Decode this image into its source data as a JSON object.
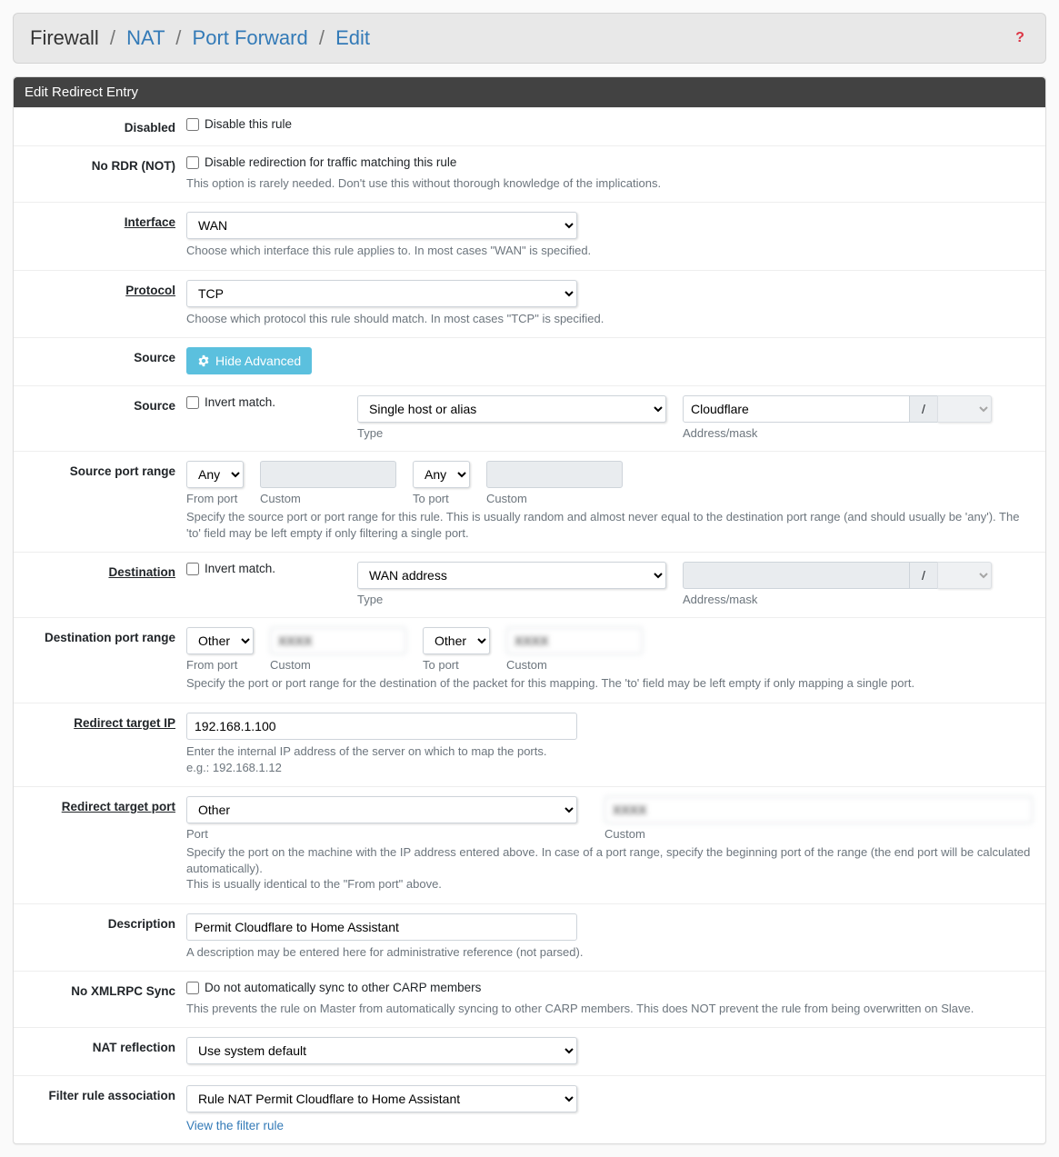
{
  "breadcrumb": {
    "firewall": "Firewall",
    "nat": "NAT",
    "pf": "Port Forward",
    "edit": "Edit"
  },
  "panel_title": "Edit Redirect Entry",
  "labels": {
    "disabled": "Disabled",
    "nordr": "No RDR (NOT)",
    "interface": "Interface",
    "protocol": "Protocol",
    "source_btn": "Source",
    "source": "Source",
    "spr": "Source port range",
    "destination": "Destination",
    "dpr": "Destination port range",
    "rtip": "Redirect target IP",
    "rtport": "Redirect target port",
    "description": "Description",
    "noxml": "No XMLRPC Sync",
    "natrefl": "NAT reflection",
    "fra": "Filter rule association"
  },
  "disabled": {
    "chk": "Disable this rule"
  },
  "nordr": {
    "chk": "Disable redirection for traffic matching this rule",
    "help": "This option is rarely needed. Don't use this without thorough knowledge of the implications."
  },
  "interface": {
    "value": "WAN",
    "help": "Choose which interface this rule applies to. In most cases \"WAN\" is specified."
  },
  "protocol": {
    "value": "TCP",
    "help": "Choose which protocol this rule should match. In most cases \"TCP\" is specified."
  },
  "source_btn": {
    "label": "Hide Advanced"
  },
  "source": {
    "invert": "Invert match.",
    "type_value": "Single host or alias",
    "type_label": "Type",
    "addr_value": "Cloudflare",
    "mask_sep": "/",
    "addr_label": "Address/mask"
  },
  "spr": {
    "from_port_value": "Any",
    "from_port_label": "From port",
    "custom1_label": "Custom",
    "to_port_value": "Any",
    "to_port_label": "To port",
    "custom2_label": "Custom",
    "help": "Specify the source port or port range for this rule. This is usually random and almost never equal to the destination port range (and should usually be 'any'). The 'to' field may be left empty if only filtering a single port."
  },
  "dest": {
    "invert": "Invert match.",
    "type_value": "WAN address",
    "type_label": "Type",
    "addr_value": "",
    "mask_sep": "/",
    "addr_label": "Address/mask"
  },
  "dpr": {
    "from_port_value": "Other",
    "from_port_label": "From port",
    "custom1_label": "Custom",
    "to_port_value": "Other",
    "to_port_label": "To port",
    "custom2_label": "Custom",
    "help": "Specify the port or port range for the destination of the packet for this mapping. The 'to' field may be left empty if only mapping a single port."
  },
  "rtip": {
    "value": "192.168.1.100",
    "help1": "Enter the internal IP address of the server on which to map the ports.",
    "help2": "e.g.: 192.168.1.12"
  },
  "rtport": {
    "port_value": "Other",
    "port_label": "Port",
    "custom_label": "Custom",
    "help1": "Specify the port on the machine with the IP address entered above. In case of a port range, specify the beginning port of the range (the end port will be calculated automatically).",
    "help2": "This is usually identical to the \"From port\" above."
  },
  "description": {
    "value": "Permit Cloudflare to Home Assistant",
    "help": "A description may be entered here for administrative reference (not parsed)."
  },
  "noxml": {
    "chk": "Do not automatically sync to other CARP members",
    "help": "This prevents the rule on Master from automatically syncing to other CARP members. This does NOT prevent the rule from being overwritten on Slave."
  },
  "natrefl": {
    "value": "Use system default"
  },
  "fra": {
    "value": "Rule NAT Permit Cloudflare to Home Assistant",
    "link": "View the filter rule"
  }
}
